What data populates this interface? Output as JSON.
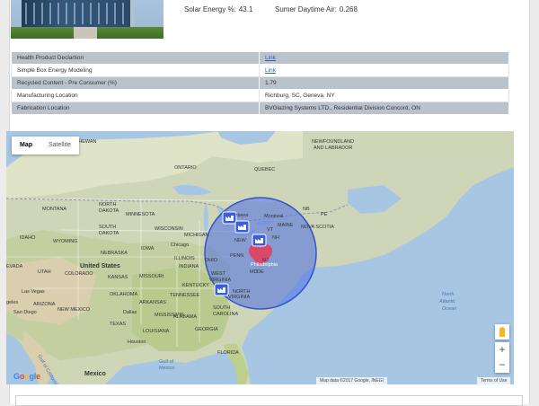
{
  "product": {
    "solar_energy_label": "Solar Energy %:",
    "solar_energy_value": "43.1",
    "daytime_air_label": "Sumer Daytime Air:",
    "daytime_air_value": "0.268"
  },
  "properties": [
    {
      "label": "Health Product Declartion",
      "value": "Link",
      "is_link": true
    },
    {
      "label": "Simple Box Energy Modeling",
      "value": "Link",
      "is_link": true
    },
    {
      "label": "Recycled Content - Pre Consumer (%)",
      "value": "1.79",
      "is_link": false
    },
    {
      "label": "Manufacturing Location",
      "value": "Richburg, SC, Geneva, NY",
      "is_link": false
    },
    {
      "label": "Fabrication Location",
      "value": "BVGlazing Systems LTD., Residential Division Concord, ON",
      "is_link": false
    }
  ],
  "map": {
    "type_options": [
      "Map",
      "Satellite"
    ],
    "selected_type": "Map",
    "zoom_in": "+",
    "zoom_out": "−",
    "attribution": "Map data ©2017 Google, INEGI",
    "terms": "Terms of Use",
    "logo": "Google",
    "labels": {
      "saskatchewan": "SASKATCHEWAN",
      "newfoundland": "NEWFOUNDLAND",
      "labrador": "AND LABRADOR",
      "ontario": "ONTARIO",
      "quebec": "QUEBEC",
      "north_dakota_1": "NORTH",
      "north_dakota_2": "DAKOTA",
      "montana": "MONTANA",
      "minnesota": "MINNESOTA",
      "south_dakota_1": "SOUTH",
      "south_dakota_2": "DAKOTA",
      "wisconsin": "WISCONSIN",
      "michigan": "MICHIGAN",
      "idaho": "IDAHO",
      "wyoming": "WYOMING",
      "iowa": "IOWA",
      "chicago": "Chicago",
      "nebraska": "NEBRASKA",
      "united_states": "United States",
      "nevada": "EVADA",
      "utah": "UTAH",
      "colorado": "COLORADO",
      "kansas": "KANSAS",
      "missouri": "MISSOURI",
      "illinois": "ILLINOIS",
      "indiana": "INDIANA",
      "ohio": "OHIO",
      "kentucky": "KENTUCKY",
      "tennessee": "TENNESSEE",
      "oklahoma": "OKLAHOMA",
      "arkansas": "ARKANSAS",
      "las_vegas": "Las Vegas",
      "angeles": "geles",
      "arizona": "ARIZONA",
      "new_mexico": "NEW MEXICO",
      "san_diego": "San Diego",
      "dallas": "Dallas",
      "texas": "TEXAS",
      "louisiana": "LOUISIANA",
      "houston": "Houston",
      "mississippi": "MISSISSIPPI",
      "alabama": "ALABAMA",
      "georgia": "GEORGIA",
      "south_carolina": "SOUTH",
      "carolina": "CAROLINA",
      "west_virginia_1": "WEST",
      "west_virginia_2": "VIRGINIA",
      "virginia": "VIRGINIA",
      "north_carolina": "NORTH",
      "florida": "FLORIDA",
      "gulf_1": "Gulf of",
      "gulf_2": "Mexico",
      "mexico": "Mexico",
      "gulf_california": "Gulf of California",
      "north_atlantic_1": "North",
      "north_atlantic_2": "Atlantic",
      "north_atlantic_3": "Ocean",
      "ottawa": "ttawa",
      "montreal": "Montreal",
      "maine": "MAINE",
      "nb": "NB",
      "pe": "PE",
      "nova_scotia": "NOVA SCOTIA",
      "vt": "VT",
      "new_york": "NEW",
      "nh": "NH",
      "penn": "PENN",
      "philadelphia": "Philadelphia",
      "md": "MD",
      "de": "DE",
      "nj": "NJ"
    }
  },
  "colors": {
    "radius_fill": "#4b6ee6",
    "radius_stroke": "#3355cc",
    "marker_fill": "#3b5fd8",
    "heart_fill": "#d94a6a"
  }
}
